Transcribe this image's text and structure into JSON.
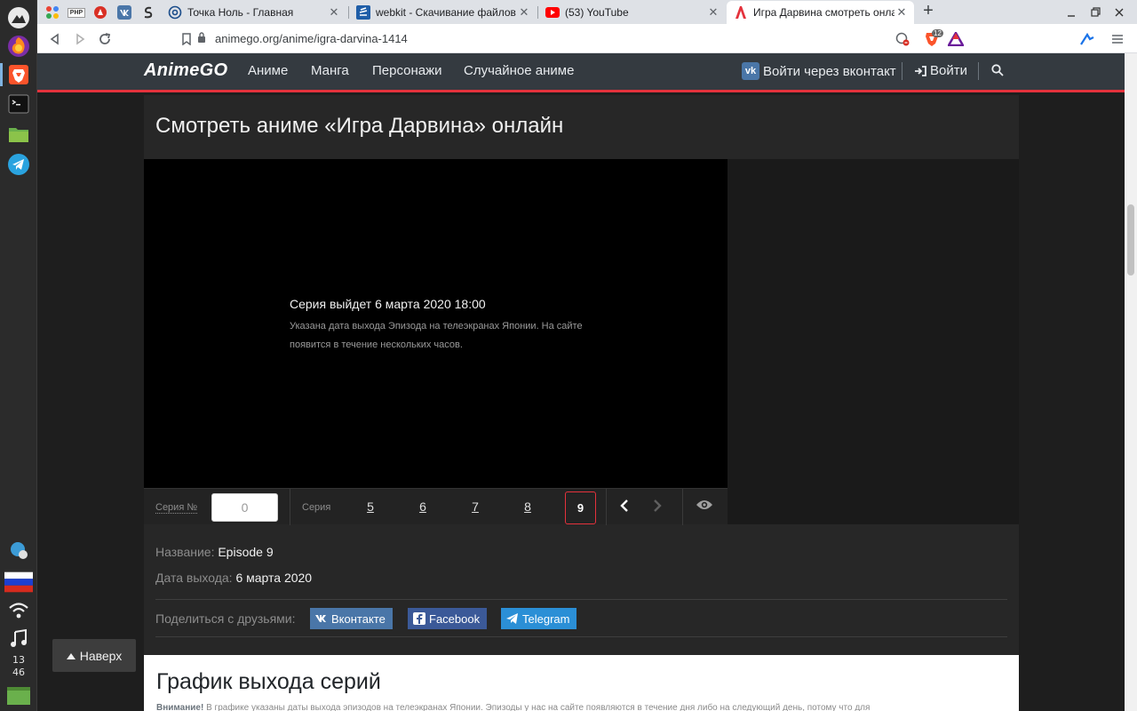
{
  "browser": {
    "tabs": [
      {
        "label": "Точка Ноль - Главная",
        "icon": "globe-icon"
      },
      {
        "label": "webkit - Скачивание файлов т",
        "icon": "stack-icon"
      },
      {
        "label": "(53) YouTube",
        "icon": "youtube-icon"
      },
      {
        "label": "Игра Дарвина смотреть онлай",
        "icon": "animego-icon"
      }
    ],
    "pinned": [
      "apps-icon",
      "php-icon",
      "notification-icon",
      "vk-icon",
      "s-icon"
    ],
    "php_text": "PHP",
    "url": "animego.org/anime/igra-darvina-1414",
    "shield_count": "12",
    "new_tab": "+"
  },
  "site": {
    "logo": "AnimeGO",
    "nav": [
      "Аниме",
      "Манга",
      "Персонажи",
      "Случайное аниме"
    ],
    "vk_login": "Войти через вконтакт",
    "login": "Войти",
    "vk_badge": "vk"
  },
  "content": {
    "title": "Смотреть аниме «Игра Дарвина» онлайн",
    "notice_title": "Серия выйдет 6 марта 2020 18:00",
    "notice_text": "Указана дата выхода Эпизода на телеэкранах Японии. На сайте появится в течение нескольких часов.",
    "episode_no_label": "Серия №",
    "episode_input_value": "0",
    "series_label": "Серия",
    "episodes": [
      "5",
      "6",
      "7",
      "8"
    ],
    "active_episode": "9",
    "name_key": "Название:",
    "name_val": "Episode 9",
    "date_key": "Дата выхода:",
    "date_val": "6 марта 2020",
    "share_label": "Поделиться с друзьями:",
    "share": [
      {
        "label": "Вконтакте",
        "color": "#4a76a8"
      },
      {
        "label": "Facebook",
        "color": "#3b5998"
      },
      {
        "label": "Telegram",
        "color": "#2b8fd6"
      }
    ]
  },
  "schedule": {
    "title": "График выхода серий",
    "note_bold": "Внимание!",
    "note_text": "В графике указаны даты выхода эпизодов на телеэкранах Японии. Эпизоды у нас на сайте появляются в течение дня либо на следующий день, потому что для"
  },
  "back_to_top": "Наверх",
  "clock": {
    "hours": "13",
    "minutes": "46"
  }
}
